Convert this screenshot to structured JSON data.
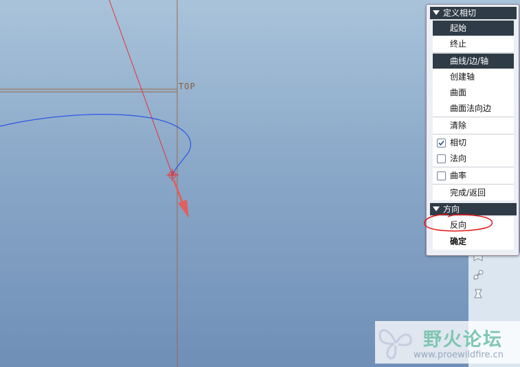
{
  "viewport": {
    "datum_label": "TOP"
  },
  "menu": {
    "section1": {
      "title": "定义相切",
      "items": [
        {
          "label": "起始",
          "selected": true
        },
        {
          "label": "终止",
          "selected": false
        },
        {
          "label": "曲线/边/轴",
          "selected": true
        },
        {
          "label": "创建轴",
          "selected": false
        },
        {
          "label": "曲面",
          "selected": false
        },
        {
          "label": "曲面法向边",
          "selected": false
        },
        {
          "label": "清除",
          "selected": false
        }
      ],
      "checkboxes": [
        {
          "label": "相切",
          "checked": true
        },
        {
          "label": "法向",
          "checked": false
        },
        {
          "label": "曲率",
          "checked": false
        }
      ],
      "done": "完成/返回"
    },
    "section2": {
      "title": "方向",
      "items": [
        {
          "label": "反向"
        },
        {
          "label": "确定"
        }
      ]
    }
  },
  "watermark": {
    "text": "野火论坛",
    "url": "www.proewildfire.cn"
  },
  "colors": {
    "curve": "#2a55e6",
    "tangent_line": "#e83030",
    "tangent_arrow": "#e06060",
    "datum_plane": "#9a6a4a",
    "annotation": "#e41414",
    "menu_header": "#2f3b47"
  }
}
